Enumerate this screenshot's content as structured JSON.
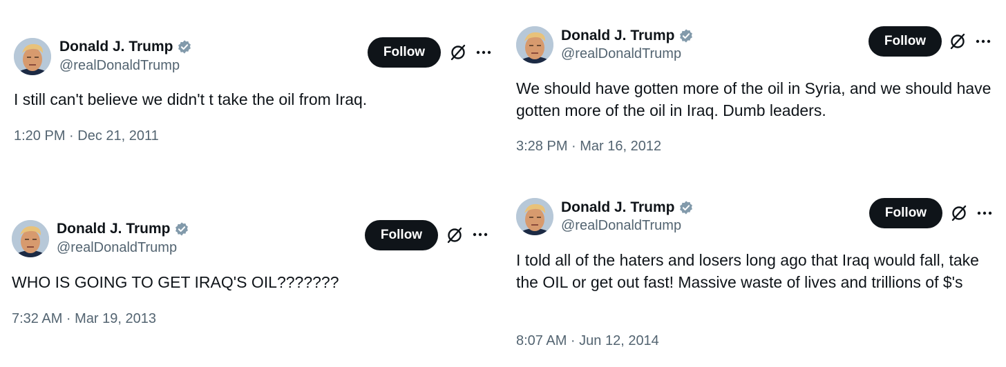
{
  "tweets": [
    {
      "author": {
        "name": "Donald J. Trump",
        "handle": "@realDonaldTrump"
      },
      "follow_label": "Follow",
      "text": "I still can't believe we didn't t take the oil from Iraq.",
      "timestamp": "1:20 PM · Dec 21, 2011"
    },
    {
      "author": {
        "name": "Donald J. Trump",
        "handle": "@realDonaldTrump"
      },
      "follow_label": "Follow",
      "text": "We should have gotten more of the oil in Syria, and we should have gotten more of the oil in Iraq. Dumb leaders.",
      "timestamp": "3:28 PM · Mar 16, 2012"
    },
    {
      "author": {
        "name": "Donald J. Trump",
        "handle": "@realDonaldTrump"
      },
      "follow_label": "Follow",
      "text": "WHO IS GOING TO GET IRAQ'S OIL???????",
      "timestamp": "7:32 AM · Mar 19, 2013"
    },
    {
      "author": {
        "name": "Donald J. Trump",
        "handle": "@realDonaldTrump"
      },
      "follow_label": "Follow",
      "text": "I told all of the haters and losers long ago that Iraq would fall, take the OIL or get out fast! Massive waste of lives and trillions of $'s",
      "timestamp": "8:07 AM · Jun 12, 2014"
    }
  ],
  "icons": {
    "verified": "verified-badge-icon",
    "grok": "grok-icon",
    "more": "more-options-icon"
  },
  "colors": {
    "text": "#0f1419",
    "secondary": "#536471",
    "button": "#0f1419",
    "verified": "#829aab"
  }
}
